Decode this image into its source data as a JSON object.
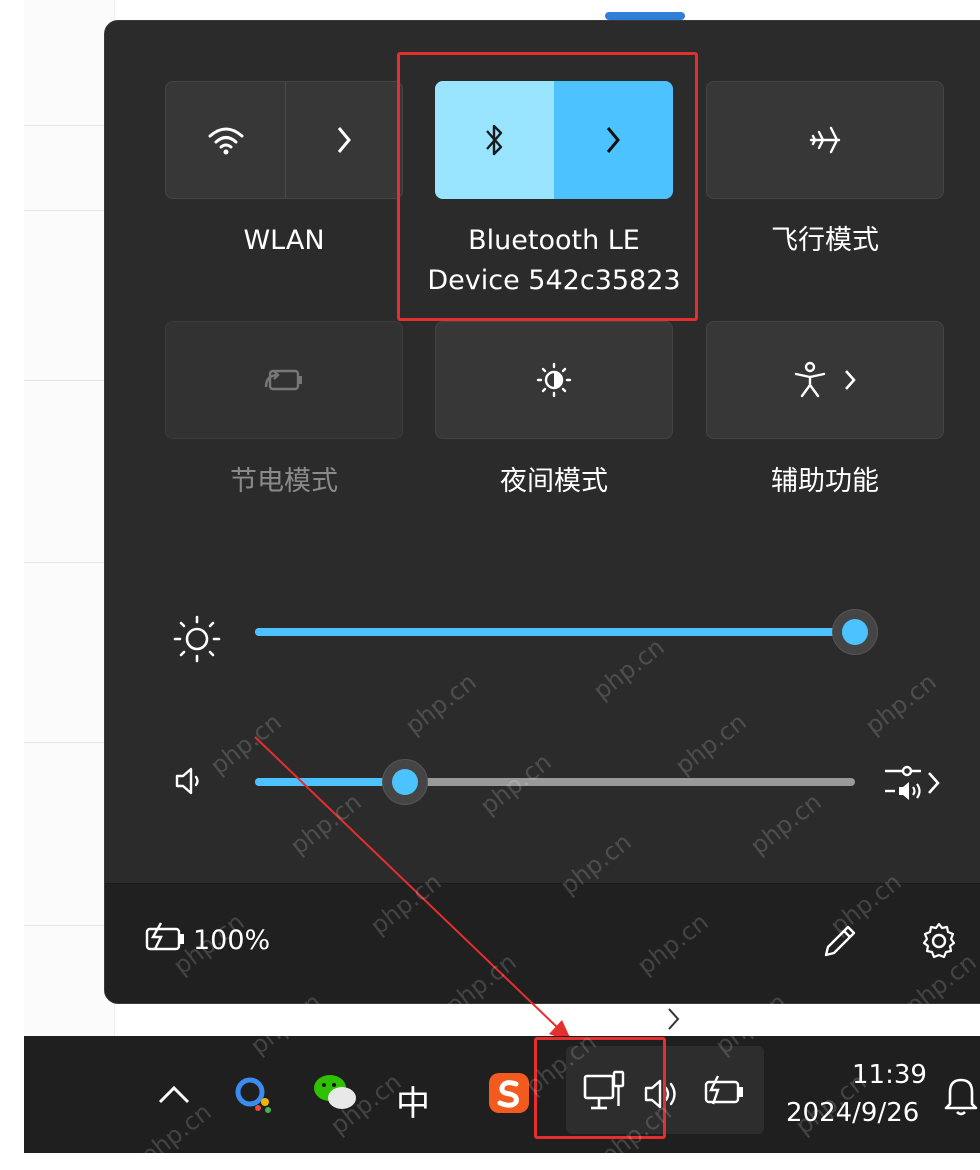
{
  "tiles": {
    "wlan": {
      "label": "WLAN"
    },
    "bluetooth": {
      "label_line1": "Bluetooth LE",
      "label_line2": "Device 542c35823"
    },
    "airplane": {
      "label": "飞行模式"
    },
    "battery_saver": {
      "label": "节电模式"
    },
    "night_light": {
      "label": "夜间模式"
    },
    "accessibility": {
      "label": "辅助功能"
    }
  },
  "sliders": {
    "brightness": {
      "value_percent": 100
    },
    "volume": {
      "value_percent": 25
    }
  },
  "footer": {
    "battery_percent": "100%"
  },
  "taskbar": {
    "ime_label": "中",
    "time": "11:39",
    "date": "2024/9/26"
  },
  "watermark": {
    "text": "php.cn"
  },
  "colors": {
    "accent": "#4cc2ff",
    "accent_light": "#99e5ff",
    "panel": "#2b2b2b",
    "highlight_box": "#e52e2e"
  }
}
